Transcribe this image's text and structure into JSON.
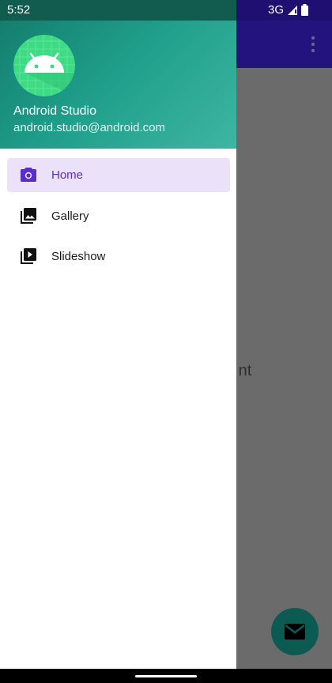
{
  "status_bar": {
    "time": "5:52",
    "network": "3G",
    "icons": [
      "signal-icon",
      "battery-icon"
    ]
  },
  "drawer": {
    "header": {
      "name": "Android Studio",
      "email": "android.studio@android.com",
      "avatar_icon": "android-logo-icon"
    },
    "items": [
      {
        "label": "Home",
        "icon": "camera-icon",
        "active": true
      },
      {
        "label": "Gallery",
        "icon": "gallery-icon",
        "active": false
      },
      {
        "label": "Slideshow",
        "icon": "slideshow-icon",
        "active": false
      }
    ]
  },
  "background": {
    "content_text": "nt",
    "fab_icon": "mail-icon"
  },
  "colors": {
    "accent": "#5a2ec9",
    "active_bg": "#ebe2fa",
    "header_start": "#137a6a",
    "header_end": "#3fb5a3",
    "toolbar": "#23137f",
    "fab": "#0d5a53"
  }
}
